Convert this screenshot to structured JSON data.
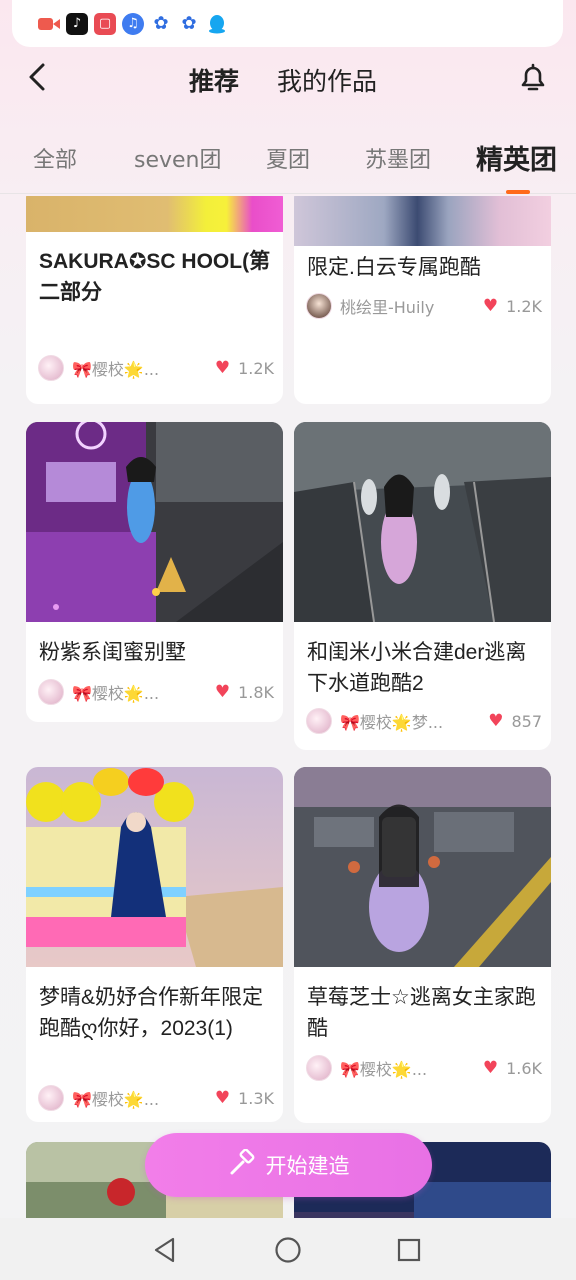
{
  "header": {
    "tabs": [
      {
        "label": "推荐",
        "active": true
      },
      {
        "label": "我的作品",
        "active": false
      }
    ]
  },
  "categories": [
    {
      "label": "全部",
      "active": false
    },
    {
      "label": "seven团",
      "active": false
    },
    {
      "label": "夏团",
      "active": false
    },
    {
      "label": "苏墨团",
      "active": false
    },
    {
      "label": "精英团",
      "active": true
    }
  ],
  "cards": [
    {
      "title": "SAKURA✪SC HOOL(第二部分",
      "author": "🎀樱校🌟...",
      "likes": "1.2K"
    },
    {
      "title": "限定.白云专属跑酷",
      "author": "桃绘里-Huily",
      "likes": "1.2K"
    },
    {
      "title": "粉紫系闺蜜别墅",
      "author": "🎀樱校🌟...",
      "likes": "1.8K"
    },
    {
      "title": "和闺米小米合建der逃离下水道跑酷2",
      "author": "🎀樱校🌟梦...",
      "likes": "857"
    },
    {
      "title": "梦晴&奶妤合作新年限定跑酷ღ你好，2023(1)",
      "author": "🎀樱校🌟...",
      "likes": "1.3K"
    },
    {
      "title": "草莓芝士☆逃离女主家跑酷",
      "author": "🎀樱校🌟...",
      "likes": "1.6K"
    }
  ],
  "build_button": {
    "label": "开始建造"
  },
  "colors": {
    "accent": "#ff6a1a",
    "heart": "#f2445a",
    "button": "#ee7ae7"
  }
}
